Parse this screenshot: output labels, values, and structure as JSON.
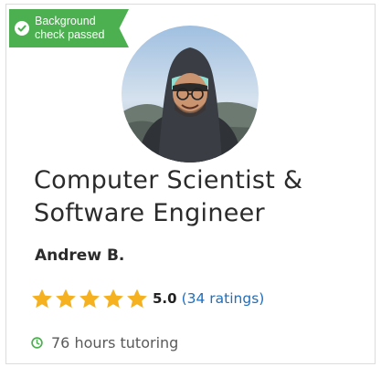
{
  "badge": {
    "line1": "Background",
    "line2": "check passed",
    "icon": "check-circle-icon",
    "color": "#4caf50"
  },
  "profile": {
    "title_line1": "Computer Scientist &",
    "title_line2": "Software Engineer",
    "name": "Andrew B.",
    "avatar": "avatar-photo"
  },
  "rating": {
    "stars": 5,
    "star_icon": "star-icon",
    "star_color": "#f5b11f",
    "score": "5.0",
    "count_label": "(34 ratings)",
    "link_color": "#1d6fc0"
  },
  "tutoring": {
    "icon": "clock-icon",
    "icon_color": "#4caf50",
    "label": "76 hours tutoring"
  }
}
